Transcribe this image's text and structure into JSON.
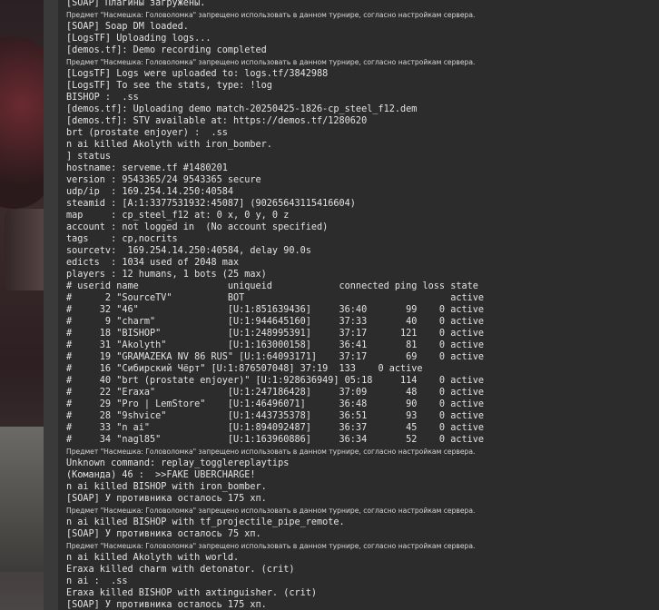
{
  "console": {
    "lines": [
      {
        "text": "[SOAP] Плагины загружены.",
        "small": false
      },
      {
        "text": "Предмет \"Насмешка: Головоломка\" запрещено использовать в данном турнире, согласно настройкам сервера.",
        "small": true
      },
      {
        "text": "[SOAP] Soap DM loaded.",
        "small": false
      },
      {
        "text": "[LogsTF] Uploading logs...",
        "small": false
      },
      {
        "text": "[demos.tf]: Demo recording completed",
        "small": false
      },
      {
        "text": "Предмет \"Насмешка: Головоломка\" запрещено использовать в данном турнире, согласно настройкам сервера.",
        "small": true
      },
      {
        "text": "[LogsTF] Logs were uploaded to: logs.tf/3842988",
        "small": false
      },
      {
        "text": "[LogsTF] To see the stats, type: !log",
        "small": false
      },
      {
        "text": "BISHOP :  .ss",
        "small": false
      },
      {
        "text": "[demos.tf]: Uploading demo match-20250425-1826-cp_steel_f12.dem",
        "small": false
      },
      {
        "text": "[demos.tf]: STV available at: https://demos.tf/1280620",
        "small": false
      },
      {
        "text": "brt (prostate enjoyer) :  .ss",
        "small": false
      },
      {
        "text": "n ai killed Akolyth with iron_bomber.",
        "small": false
      },
      {
        "text": "] status",
        "small": false
      },
      {
        "text": "hostname: serveme.tf #1480201",
        "small": false
      },
      {
        "text": "version : 9543365/24 9543365 secure",
        "small": false
      },
      {
        "text": "udp/ip  : 169.254.14.250:40584",
        "small": false
      },
      {
        "text": "steamid : [A:1:3377531932:45087] (90265643115416604)",
        "small": false
      },
      {
        "text": "map     : cp_steel_f12 at: 0 x, 0 y, 0 z",
        "small": false
      },
      {
        "text": "account : not logged in  (No account specified)",
        "small": false
      },
      {
        "text": "tags    : cp,nocrits",
        "small": false
      },
      {
        "text": "sourcetv:  169.254.14.250:40584, delay 90.0s",
        "small": false
      },
      {
        "text": "edicts  : 1034 used of 2048 max",
        "small": false
      },
      {
        "text": "players : 12 humans, 1 bots (25 max)",
        "small": false
      },
      {
        "text": "# userid name                uniqueid            connected ping loss state",
        "small": false
      },
      {
        "text": "#      2 \"SourceTV\"          BOT                                     active",
        "small": false
      },
      {
        "text": "#     32 \"46\"                [U:1:851639436]     36:40       99    0 active",
        "small": false
      },
      {
        "text": "#      9 \"charm\"             [U:1:944645160]     37:33       40    0 active",
        "small": false
      },
      {
        "text": "#     18 \"BISHOP\"            [U:1:248995391]     37:17      121    0 active",
        "small": false
      },
      {
        "text": "#     31 \"Akolyth\"           [U:1:163000158]     36:41       81    0 active",
        "small": false
      },
      {
        "text": "#     19 \"GRAMAZEKA NV 86 RUS\" [U:1:64093171]    37:17       69    0 active",
        "small": false
      },
      {
        "text": "#     16 \"Сибирский Чёрт\" [U:1:876507048] 37:19  133    0 active",
        "small": false
      },
      {
        "text": "#     40 \"brt (prostate enjoyer)\" [U:1:928636949] 05:18     114    0 active",
        "small": false
      },
      {
        "text": "#     22 \"Eraxa\"             [U:1:247186428]     37:09       48    0 active",
        "small": false
      },
      {
        "text": "#     29 \"Pro | LemStore\"    [U:1:46496071]      36:48       90    0 active",
        "small": false
      },
      {
        "text": "#     28 \"9shvice\"           [U:1:443735378]     36:51       93    0 active",
        "small": false
      },
      {
        "text": "#     33 \"n ai\"              [U:1:894092487]     36:37       45    0 active",
        "small": false
      },
      {
        "text": "#     34 \"nagl85\"            [U:1:163960886]     36:34       52    0 active",
        "small": false
      },
      {
        "text": "Предмет \"Насмешка: Головоломка\" запрещено использовать в данном турнире, согласно настройкам сервера.",
        "small": true
      },
      {
        "text": "Unknown command: replay_togglereplaytips",
        "small": false
      },
      {
        "text": "(Команда) 46 :  >>FAKE UBERCHARGE!",
        "small": false
      },
      {
        "text": "n ai killed BISHOP with iron_bomber.",
        "small": false
      },
      {
        "text": "[SOAP] У противника осталось 175 хп.",
        "small": false
      },
      {
        "text": "Предмет \"Насмешка: Головоломка\" запрещено использовать в данном турнире, согласно настройкам сервера.",
        "small": true
      },
      {
        "text": "n ai killed BISHOP with tf_projectile_pipe_remote.",
        "small": false
      },
      {
        "text": "[SOAP] У противника осталось 75 хп.",
        "small": false
      },
      {
        "text": "Предмет \"Насмешка: Головоломка\" запрещено использовать в данном турнире, согласно настройкам сервера.",
        "small": true
      },
      {
        "text": "n ai killed Akolyth with world.",
        "small": false
      },
      {
        "text": "Eraxa killed charm with detonator. (crit)",
        "small": false
      },
      {
        "text": "n ai :  .ss",
        "small": false
      },
      {
        "text": "Eraxa killed BISHOP with axtinguisher. (crit)",
        "small": false
      },
      {
        "text": "[SOAP] У противника осталось 175 хп.",
        "small": false
      }
    ]
  }
}
